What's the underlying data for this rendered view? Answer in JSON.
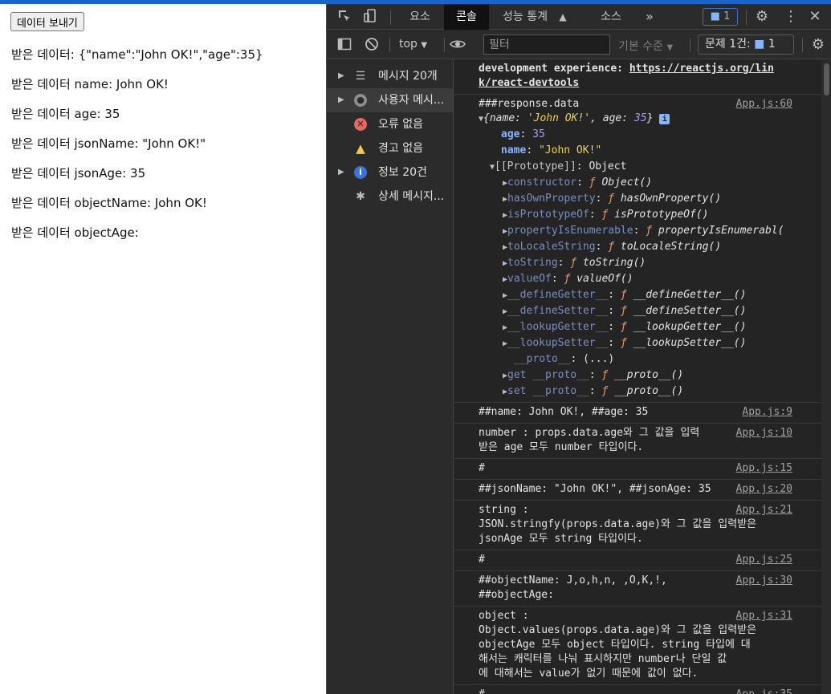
{
  "page": {
    "send_button": "데이터 보내기",
    "lines": [
      "받은 데이터: {\"name\":\"John OK!\",\"age\":35}",
      "받은 데이터 name: John OK!",
      "받은 데이터 age: 35",
      "받은 데이터 jsonName: \"John OK!\"",
      "받은 데이터 jsonAge: 35",
      "받은 데이터 objectName: John OK!",
      "받은 데이터 objectAge:"
    ]
  },
  "devtools": {
    "tabs": [
      "요소",
      "콘솔",
      "성능 통계",
      "소스",
      "»"
    ],
    "active_tab": "콘솔",
    "issue_badge": "1",
    "toolbar": {
      "context": "top",
      "filter_placeholder": "필터",
      "level": "기본 수준",
      "issues_label": "문제 1건:",
      "issues_count": "1"
    },
    "sidebar": [
      {
        "label": "메시지 20개",
        "icon": "list-icon"
      },
      {
        "label": "사용자 메시...",
        "icon": "user-icon"
      },
      {
        "label": "오류 없음",
        "icon": "error-icon"
      },
      {
        "label": "경고 없음",
        "icon": "warning-icon"
      },
      {
        "label": "정보 20건",
        "icon": "info-icon"
      },
      {
        "label": "상세 메시지...",
        "icon": "bug-icon"
      }
    ],
    "console": {
      "devtools_msg": [
        "development experience: ",
        "https://reactjs.org/lin",
        "k/react-devtools"
      ],
      "response_header": "###response.data",
      "response_link": "App.js:60",
      "obj_preview": {
        "name_key": "name",
        "name_val": "'John OK!'",
        "age_key": "age",
        "age_val": "35"
      },
      "obj_age": {
        "key": "age",
        "val": "35"
      },
      "obj_name": {
        "key": "name",
        "val": "\"John OK!\""
      },
      "prototype": {
        "key": "[[Prototype]]",
        "val": "Object"
      },
      "proto_methods": [
        {
          "key": "constructor",
          "fn": "Object()"
        },
        {
          "key": "hasOwnProperty",
          "fn": "hasOwnProperty()"
        },
        {
          "key": "isPrototypeOf",
          "fn": "isPrototypeOf()"
        },
        {
          "key": "propertyIsEnumerable",
          "fn": "propertyIsEnumerabl("
        },
        {
          "key": "toLocaleString",
          "fn": "toLocaleString()"
        },
        {
          "key": "toString",
          "fn": "toString()"
        },
        {
          "key": "valueOf",
          "fn": "valueOf()"
        },
        {
          "key": "__defineGetter__",
          "fn": "__defineGetter__()"
        },
        {
          "key": "__defineSetter__",
          "fn": "__defineSetter__()"
        },
        {
          "key": "__lookupGetter__",
          "fn": "__lookupGetter__()"
        },
        {
          "key": "__lookupSetter__",
          "fn": "__lookupSetter__()"
        }
      ],
      "proto_dunder": {
        "key": "__proto__",
        "val": "(...)"
      },
      "proto_get": {
        "kw": "get",
        "key": "__proto__",
        "fn": "__proto__()"
      },
      "proto_set": {
        "kw": "set",
        "key": "__proto__",
        "fn": "__proto__()"
      },
      "messages": [
        {
          "text": "##name: John OK!, ##age: 35",
          "link": "App.js:9"
        },
        {
          "text": "number : props.data.age와 그 값을 입력\n받은 age 모두 number 타입이다.",
          "link": "App.js:10"
        },
        {
          "text": "#",
          "link": "App.js:15"
        },
        {
          "text": "##jsonName: \"John OK!\", ##jsonAge: 35",
          "link": "App.js:20"
        },
        {
          "text": "string :\nJSON.stringfy(props.data.age)와 그 값을 입력받은\njsonAge 모두 string 타입이다.",
          "link": "App.js:21"
        },
        {
          "text": "#",
          "link": "App.js:25"
        },
        {
          "text": "##objectName: J,o,h,n, ,O,K,!,\n##objectAge:",
          "link": "App.js:30"
        },
        {
          "text": "object :\nObject.values(props.data.age)와 그 값을 입력받은\nobjectAge 모두 object 타입이다. string 타입에 대\n해서는 캐릭터를 나눠 표시하지만 number나 단일 값\n에 대해서는 value가 없기 때문에 값이 없다.",
          "link": "App.js:31"
        },
        {
          "text": "#",
          "link": "App.js:35"
        }
      ]
    }
  }
}
